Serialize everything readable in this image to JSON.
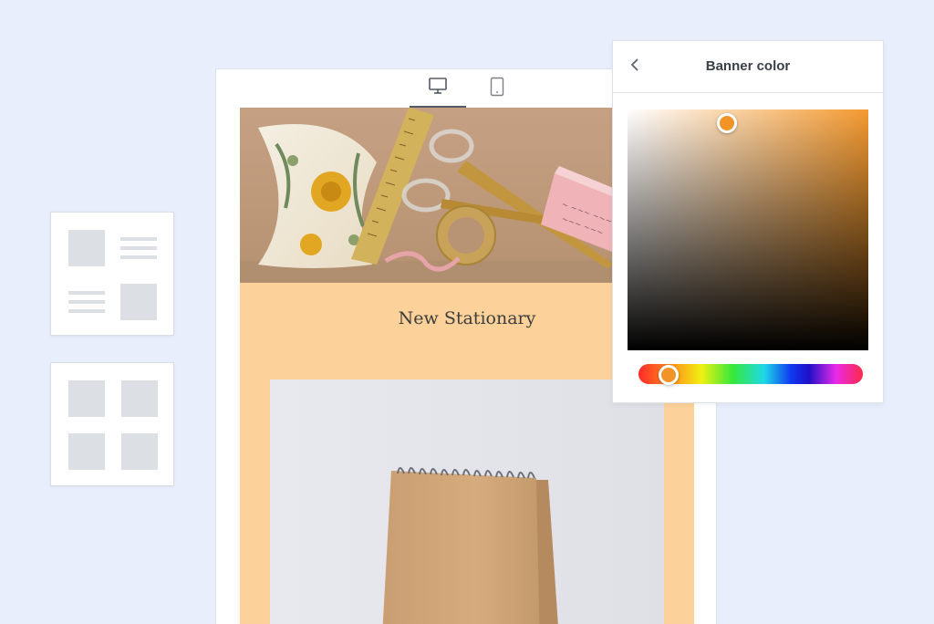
{
  "color_picker": {
    "title": "Banner color",
    "back_icon": "chevron-left-icon",
    "selected_color": "#f29327",
    "base_hue_color": "#f49a30"
  },
  "email": {
    "headline": "New Stationary",
    "background_color": "#fdd19a"
  },
  "editor": {
    "view_options": [
      "desktop-icon",
      "tablet-icon"
    ],
    "active_view": "desktop"
  },
  "layouts": {
    "options": [
      "image-text-alternating-layout",
      "grid-2x2-layout"
    ]
  }
}
